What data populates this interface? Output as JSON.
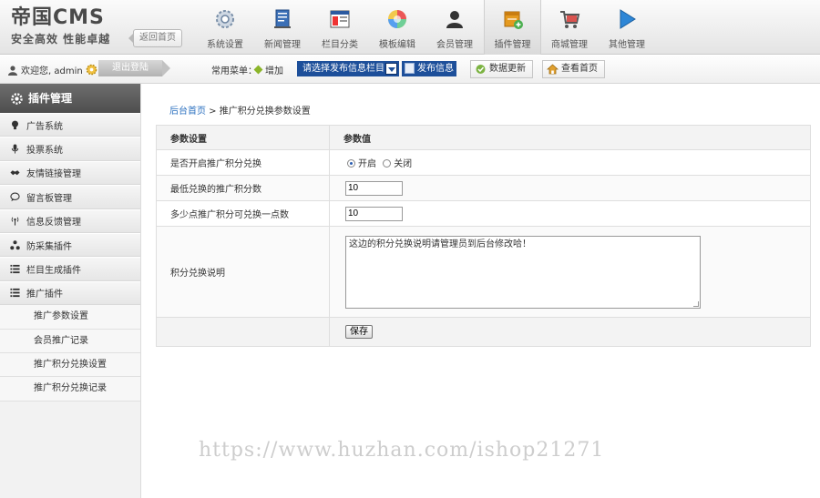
{
  "logo": {
    "main": "帝国CMS",
    "sub": "安全高效 性能卓越"
  },
  "back_home": "返回首页",
  "nav": [
    {
      "label": "系统设置",
      "icon": "gear-icon"
    },
    {
      "label": "新闻管理",
      "icon": "document-icon"
    },
    {
      "label": "栏目分类",
      "icon": "window-icon"
    },
    {
      "label": "模板编辑",
      "icon": "palette-icon"
    },
    {
      "label": "会员管理",
      "icon": "user-icon"
    },
    {
      "label": "插件管理",
      "icon": "plugin-box-icon"
    },
    {
      "label": "商城管理",
      "icon": "cart-icon"
    },
    {
      "label": "其他管理",
      "icon": "play-icon"
    }
  ],
  "active_nav": "插件管理",
  "toolbar": {
    "welcome": "欢迎您, admin",
    "logout": "退出登陆",
    "common_menu": "常用菜单：",
    "add": "增加",
    "select_column": "请选择发布信息栏目",
    "publish": "发布信息",
    "update_data": "数据更新",
    "view_home": "查看首页"
  },
  "sidebar": {
    "title": "插件管理",
    "items": [
      {
        "label": "广告系统",
        "icon": "bulb-icon"
      },
      {
        "label": "投票系统",
        "icon": "microphone-icon"
      },
      {
        "label": "友情链接管理",
        "icon": "handshake-icon"
      },
      {
        "label": "留言板管理",
        "icon": "chat-bubble-icon"
      },
      {
        "label": "信息反馈管理",
        "icon": "antenna-icon"
      },
      {
        "label": "防采集插件",
        "icon": "network-icon"
      },
      {
        "label": "栏目生成插件",
        "icon": "list-icon"
      },
      {
        "label": "推广插件",
        "icon": "list-icon"
      }
    ],
    "subitems": [
      "推广参数设置",
      "会员推广记录",
      "推广积分兑换设置",
      "推广积分兑换记录"
    ]
  },
  "breadcrumb": {
    "home": "后台首页",
    "sep": " > ",
    "current": "推广积分兑换参数设置"
  },
  "table": {
    "header_param": "参数设置",
    "header_value": "参数值",
    "row_enable": {
      "label": "是否开启推广积分兑换",
      "on": "开启",
      "off": "关闭",
      "selected": "on"
    },
    "row_min": {
      "label": "最低兑换的推广积分数",
      "value": "10"
    },
    "row_rate": {
      "label": "多少点推广积分可兑换一点数",
      "value": "10"
    },
    "row_desc": {
      "label": "积分兑换说明",
      "value": "这边的积分兑换说明请管理员到后台修改哈！"
    },
    "save": "保存"
  },
  "watermark": "https://www.huzhan.com/ishop21271"
}
